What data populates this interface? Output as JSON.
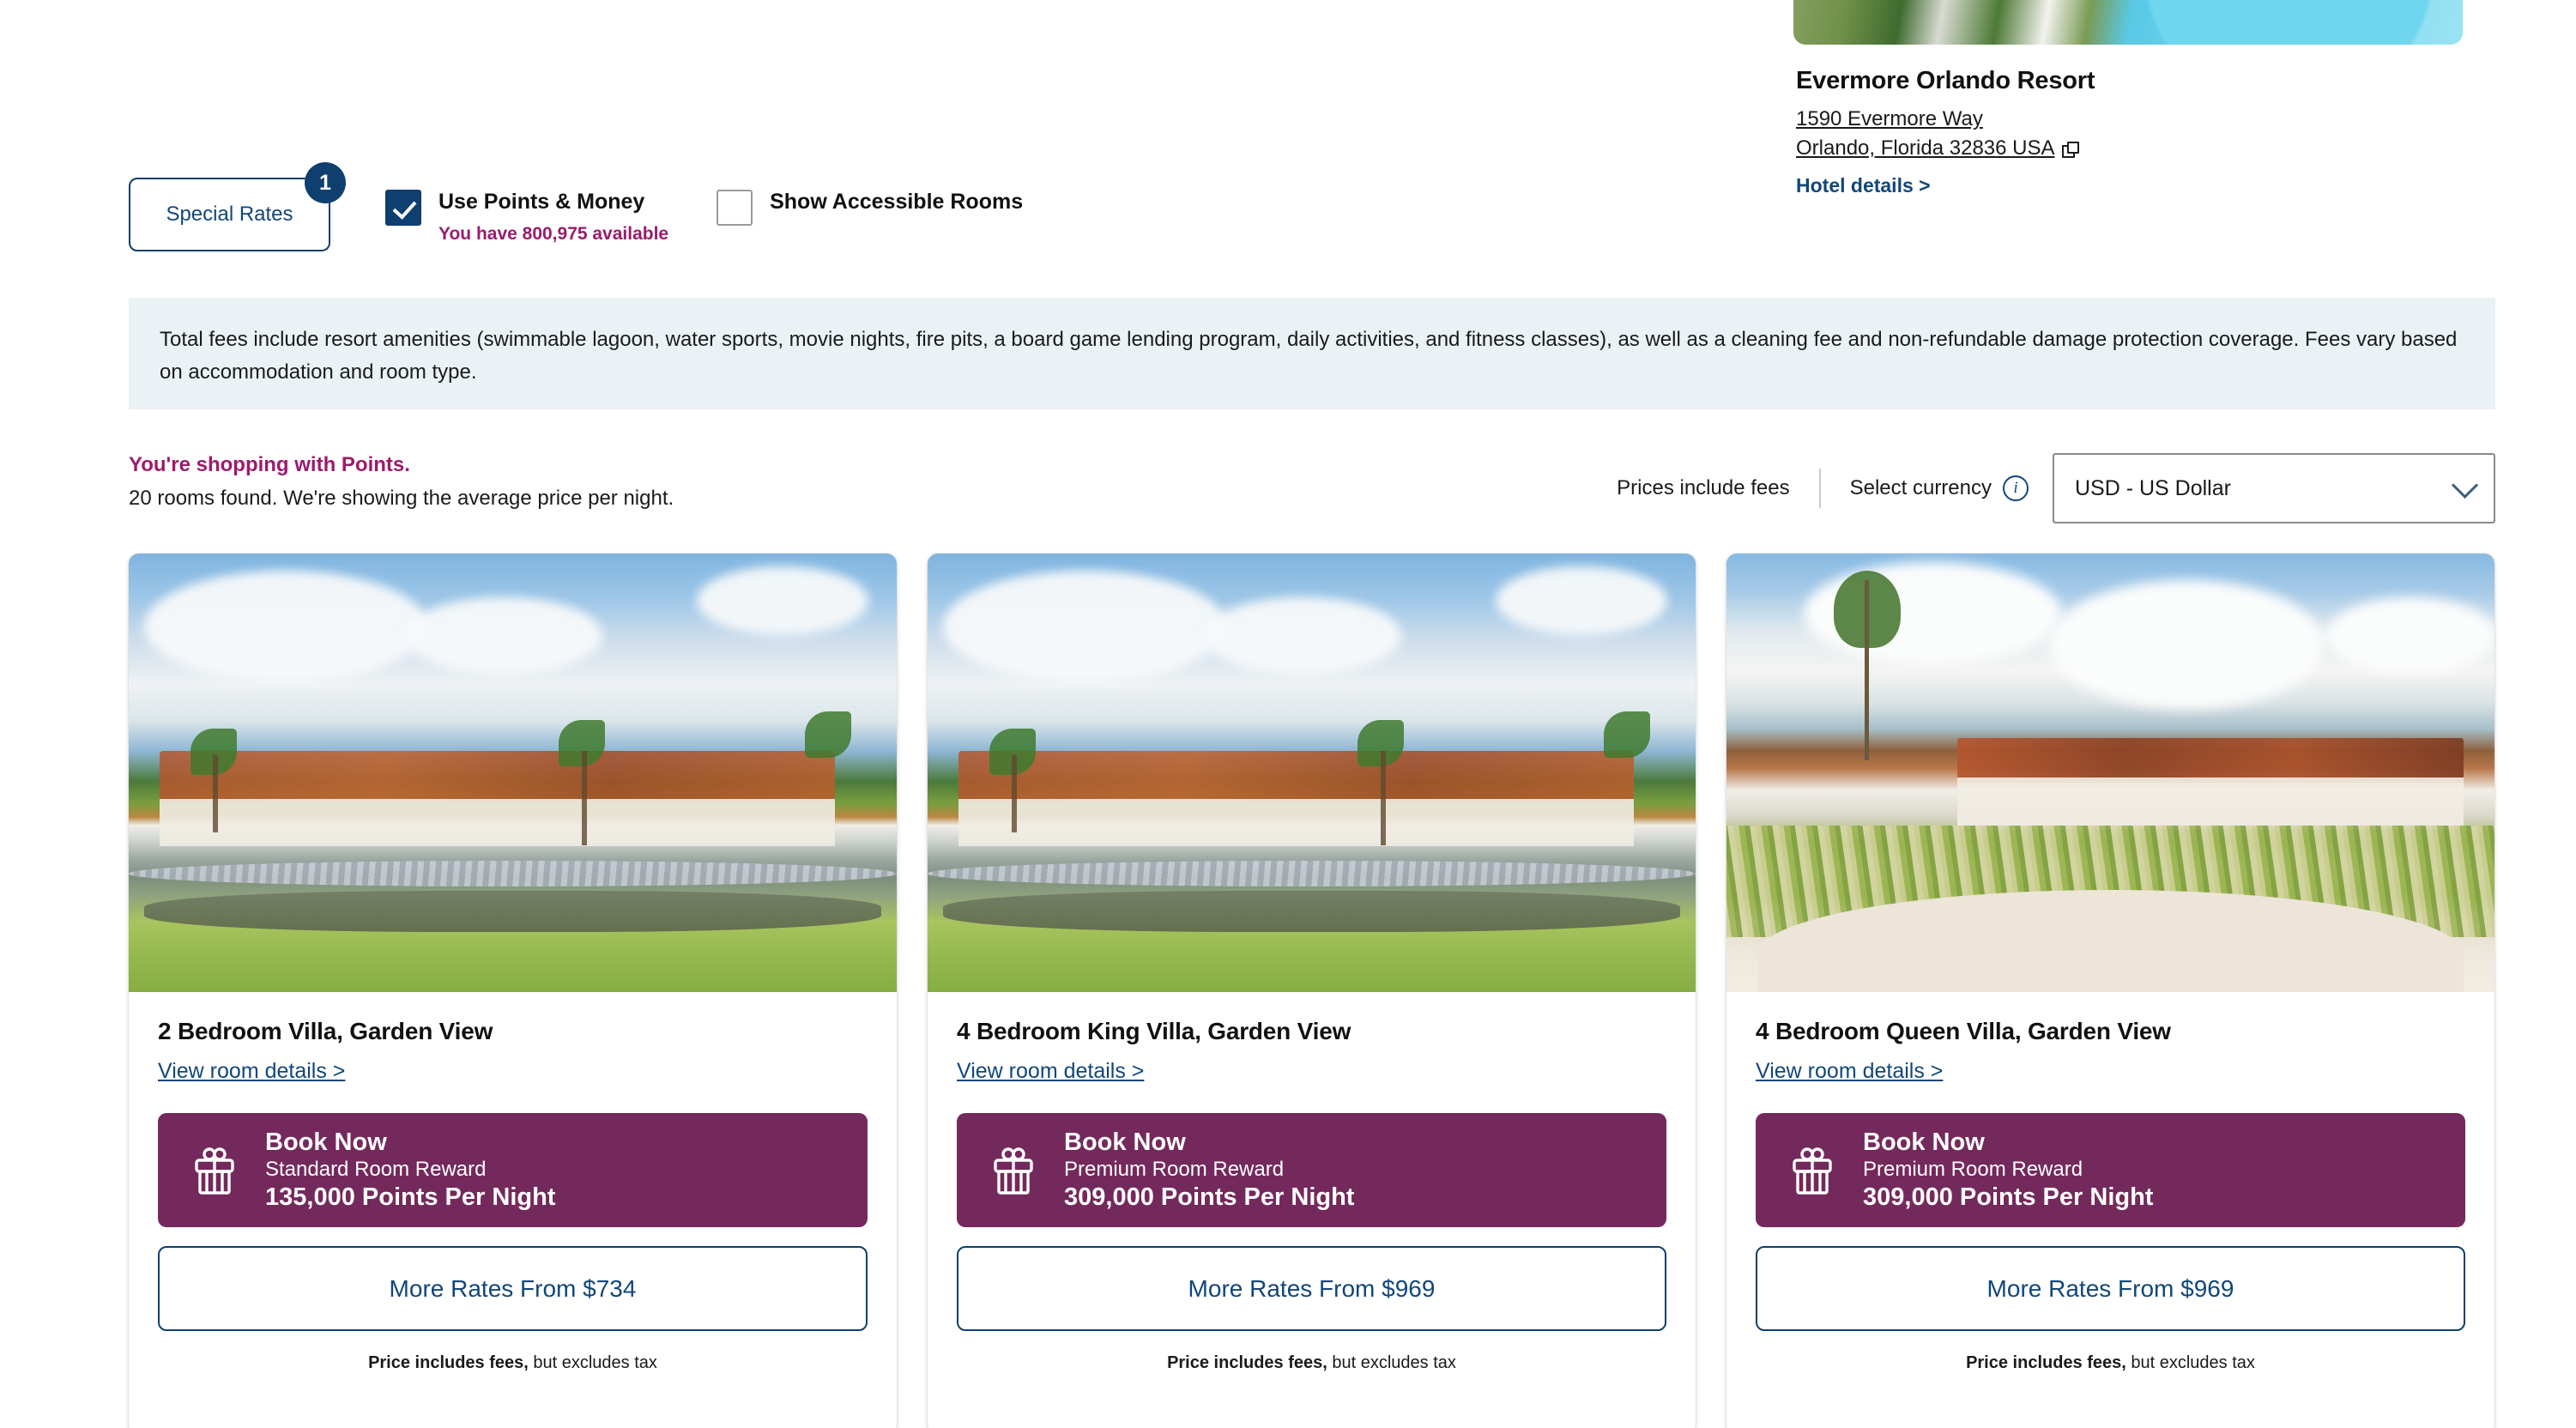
{
  "hotel": {
    "name": "Evermore Orlando Resort",
    "address_line1": "1590 Evermore Way",
    "address_line2": "Orlando, Florida 32836 USA",
    "details_link": "Hotel details >",
    "map_icon": "external-link-icon",
    "hero_image_alt": "resort-pool-aerial"
  },
  "filters": {
    "special_rates_label": "Special Rates",
    "special_rates_badge": "1",
    "points_money": {
      "label": "Use Points & Money",
      "checked": true,
      "sub_label": "You have 800,975 available"
    },
    "accessible_rooms": {
      "label": "Show Accessible Rooms",
      "checked": false
    }
  },
  "fees_banner": {
    "text": "Total fees include resort amenities (swimmable lagoon, water sports, movie nights, fire pits, a board game lending program, daily activities, and fitness classes), as well as a cleaning fee and non-refundable damage protection coverage. Fees vary based on accommodation and room type.",
    "background": "#eaf2f5"
  },
  "results": {
    "shopping_headline": "You're shopping with Points.",
    "rooms_found": "20 rooms found. We're showing the average price per night.",
    "prices_include_fees": "Prices include fees",
    "select_currency_label": "Select currency",
    "info_icon": "info-icon",
    "currency_value": "USD - US Dollar",
    "chevron_icon": "chevron-down-icon"
  },
  "colors": {
    "brand_navy": "#0f3f6e",
    "link_blue": "#11467b",
    "brand_purple": "#74295c",
    "magenta": "#9b1b6c",
    "banner_bg": "#eaf2f5"
  },
  "rooms": [
    {
      "title": "2 Bedroom Villa, Garden View",
      "details_link": "View room details >",
      "image": "villa-pond-exterior",
      "book": {
        "cta": "Book Now",
        "reward_type": "Standard Room Reward",
        "points": "135,000 Points Per Night",
        "icon": "gift-icon"
      },
      "more_rates": "More Rates From $734",
      "fee_note_bold": "Price includes fees,",
      "fee_note_rest": " but excludes tax"
    },
    {
      "title": "4 Bedroom King Villa, Garden View",
      "details_link": "View room details >",
      "image": "villa-pond-exterior",
      "book": {
        "cta": "Book Now",
        "reward_type": "Premium Room Reward",
        "points": "309,000 Points Per Night",
        "icon": "gift-icon"
      },
      "more_rates": "More Rates From $969",
      "fee_note_bold": "Price includes fees,",
      "fee_note_rest": " but excludes tax"
    },
    {
      "title": "4 Bedroom Queen Villa, Garden View",
      "details_link": "View room details >",
      "image": "villa-sand-courtyard",
      "book": {
        "cta": "Book Now",
        "reward_type": "Premium Room Reward",
        "points": "309,000 Points Per Night",
        "icon": "gift-icon"
      },
      "more_rates": "More Rates From $969",
      "fee_note_bold": "Price includes fees,",
      "fee_note_rest": " but excludes tax"
    }
  ]
}
